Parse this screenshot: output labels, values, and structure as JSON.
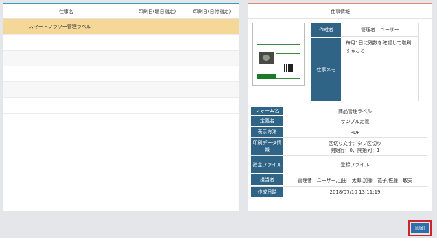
{
  "job_list": {
    "headers": {
      "name": "仕事名",
      "print_day": "印刷日(曜日指定)",
      "print_date": "印刷日(日付指定)"
    },
    "rows": [
      {
        "name": "スマートフラワー管理ラベル",
        "print_day": "",
        "print_date": ""
      }
    ]
  },
  "job_info": {
    "title": "仕事情報",
    "creator_label": "作成者",
    "creator_value": "管理者　ユーザー",
    "memo_label": "仕事メモ",
    "memo_value": "毎月1日に残数を確認して増刷すること",
    "details": [
      {
        "label": "フォーム名",
        "lines": [
          "商品管理ラベル"
        ]
      },
      {
        "label": "定義名",
        "lines": [
          "サンプル定義"
        ]
      },
      {
        "label": "表示方法",
        "lines": [
          "PDF"
        ]
      },
      {
        "label": "印刷データ情報",
        "lines": [
          "区切り文字：タブ区切り",
          "開始行：0、開始列：1"
        ]
      },
      {
        "label": "指定ファイル",
        "lines": [
          "登録ファイル"
        ]
      },
      {
        "label": "担当者",
        "lines": [
          "管理者　ユーザー,山田　太郎,加藤　花子,佐藤　敏夫"
        ]
      },
      {
        "label": "作成日時",
        "lines": [
          "2018/07/10 13:11:19"
        ]
      }
    ]
  },
  "actions": {
    "print_label": "印刷"
  },
  "colors": {
    "header_accent_left": "#3a9bbf",
    "header_accent_right": "#e8876e",
    "label_bg": "#2f6487",
    "selected_row": "#f5d798",
    "button_bg": "#2f6ea8",
    "button_border": "#d0242b"
  }
}
